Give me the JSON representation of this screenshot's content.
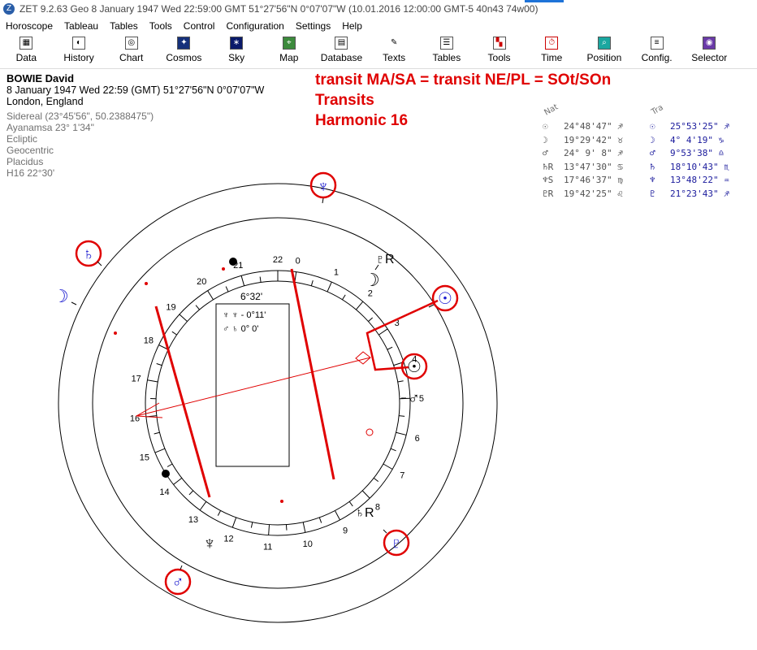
{
  "window": {
    "title": "ZET 9.2.63 Geo    8 January 1947  Wed  22:59:00 GMT 51°27'56\"N  0°07'07\"W  (10.01.2016  12:00:00 GMT-5 40n43 74w00)"
  },
  "menu": [
    "Horoscope",
    "Tableau",
    "Tables",
    "Tools",
    "Control",
    "Configuration",
    "Settings",
    "Help"
  ],
  "toolbar": [
    {
      "label": "Data",
      "icon": "data-icon"
    },
    {
      "label": "History",
      "icon": "history-icon"
    },
    {
      "label": "Chart",
      "icon": "chart-icon"
    },
    {
      "label": "Cosmos",
      "icon": "cosmos-icon"
    },
    {
      "label": "Sky",
      "icon": "sky-icon"
    },
    {
      "label": "Map",
      "icon": "map-icon"
    },
    {
      "label": "Database",
      "icon": "database-icon"
    },
    {
      "label": "Texts",
      "icon": "texts-icon"
    },
    {
      "label": "Tables",
      "icon": "tables-icon"
    },
    {
      "label": "Tools",
      "icon": "tools-icon"
    },
    {
      "label": "Time",
      "icon": "time-icon"
    },
    {
      "label": "Position",
      "icon": "position-icon"
    },
    {
      "label": "Config.",
      "icon": "config-icon"
    },
    {
      "label": "Selector",
      "icon": "selector-icon"
    }
  ],
  "person": {
    "name": "BOWIE David",
    "datetime": "8 January 1947  Wed  22:59 (GMT) 51°27'56\"N  0°07'07\"W",
    "place": "London, England",
    "settings": [
      "Sidereal (23°45'56\", 50.2388475\")",
      "Ayanamsa 23° 1'34\"",
      "Ecliptic",
      "Geocentric",
      "Placidus",
      "H16  22°30'"
    ]
  },
  "notes": [
    "transit   MA/SA = transit   NE/PL = SOt/SOn",
    "Transits",
    "Harmonic 16"
  ],
  "positions": {
    "natal_header": "Nat",
    "transit_header": "Tra",
    "rows": [
      {
        "natal_symbol": "☉",
        "natal": "24°48'47\" ♐",
        "transit_symbol": "☉",
        "transit": "25°53'25\" ♐"
      },
      {
        "natal_symbol": "☽",
        "natal": "19°29'42\" ♉",
        "transit_symbol": "☽",
        "transit": " 4° 4'19\" ♑"
      },
      {
        "natal_symbol": "♂",
        "natal": "24° 9' 8\" ♐",
        "transit_symbol": "♂",
        "transit": " 9°53'38\" ♎"
      },
      {
        "natal_symbol": "♄R",
        "natal": "13°47'30\" ♋",
        "transit_symbol": "♄",
        "transit": "18°10'43\" ♏"
      },
      {
        "natal_symbol": "♆S",
        "natal": "17°46'37\" ♍",
        "transit_symbol": "♆",
        "transit": "13°48'22\" ♒"
      },
      {
        "natal_symbol": "♇R",
        "natal": "19°42'25\" ♌",
        "transit_symbol": "♇",
        "transit": "21°23'43\" ♐"
      }
    ]
  },
  "chart": {
    "center_degree": "6°32'",
    "aspect_box": [
      "♆ ♆ - 0°11'",
      "♂ ♄  0° 0'"
    ],
    "dial_numbers": [
      "0",
      "1",
      "2",
      "3",
      "4",
      "5",
      "6",
      "7",
      "8",
      "9",
      "10",
      "11",
      "12",
      "13",
      "14",
      "15",
      "16",
      "17",
      "18",
      "19",
      "20",
      "21",
      "22"
    ],
    "planets": {
      "neptune_top": "♆",
      "pluto_right": "♇R",
      "moon_right": "☽",
      "sun_right": "☉",
      "sun_right2": "☉",
      "mars_right": "♂",
      "saturn_left": "♄",
      "moon_left": "☽",
      "neptune_bottom": "♆",
      "saturn_bottom": "♄R",
      "pluto_bottom": "♇",
      "mars_bottom": "♂"
    },
    "colors": {
      "highlight": "#e00000",
      "planet_blue": "#1b1bd0",
      "line_red": "#e00000"
    }
  }
}
